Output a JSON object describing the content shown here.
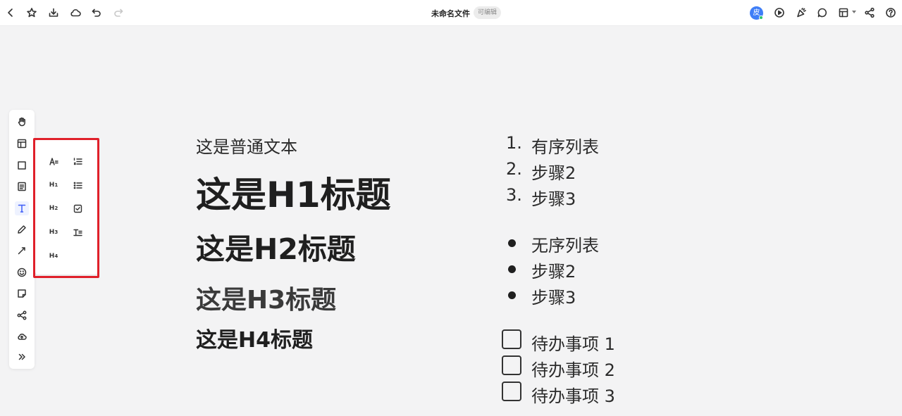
{
  "topbar": {
    "title": "未命名文件",
    "badge": "可编辑",
    "avatar_text": "皮",
    "left_icons": [
      "back-icon",
      "star-icon",
      "download-icon",
      "cloud-icon",
      "undo-icon",
      "redo-icon"
    ],
    "right_icons": [
      "present-icon",
      "celebrate-icon",
      "comment-icon",
      "layout-icon",
      "share-icon",
      "help-icon"
    ],
    "accent_color": "#3f7ef7"
  },
  "left_toolbar": {
    "items": [
      "hand-icon",
      "template-icon",
      "shape-icon",
      "note-icon",
      "text-icon",
      "pen-icon",
      "connector-icon",
      "emoji-icon",
      "sticky-icon",
      "mindmap-icon",
      "upload-icon",
      "more-icon"
    ],
    "active": "text-icon",
    "active_color": "#3f5ef7"
  },
  "format_panel": {
    "h1_label": "H",
    "h1_sub": "1",
    "h2_label": "H",
    "h2_sub": "2",
    "h3_label": "H",
    "h3_sub": "3",
    "h4_label": "H",
    "h4_sub": "4",
    "highlight_color": "#e0202a"
  },
  "canvas": {
    "normal_text": "这是普通文本",
    "h1": "这是H1标题",
    "h2": "这是H2标题",
    "h3": "这是H3标题",
    "h4": "这是H4标题",
    "ordered_list": [
      {
        "num": "1.",
        "text": "有序列表"
      },
      {
        "num": "2.",
        "text": "步骤2"
      },
      {
        "num": "3.",
        "text": "步骤3"
      }
    ],
    "bullet_list": [
      "无序列表",
      "步骤2",
      "步骤3"
    ],
    "todo_list": [
      "待办事项 1",
      "待办事项 2",
      "待办事项 3"
    ]
  }
}
